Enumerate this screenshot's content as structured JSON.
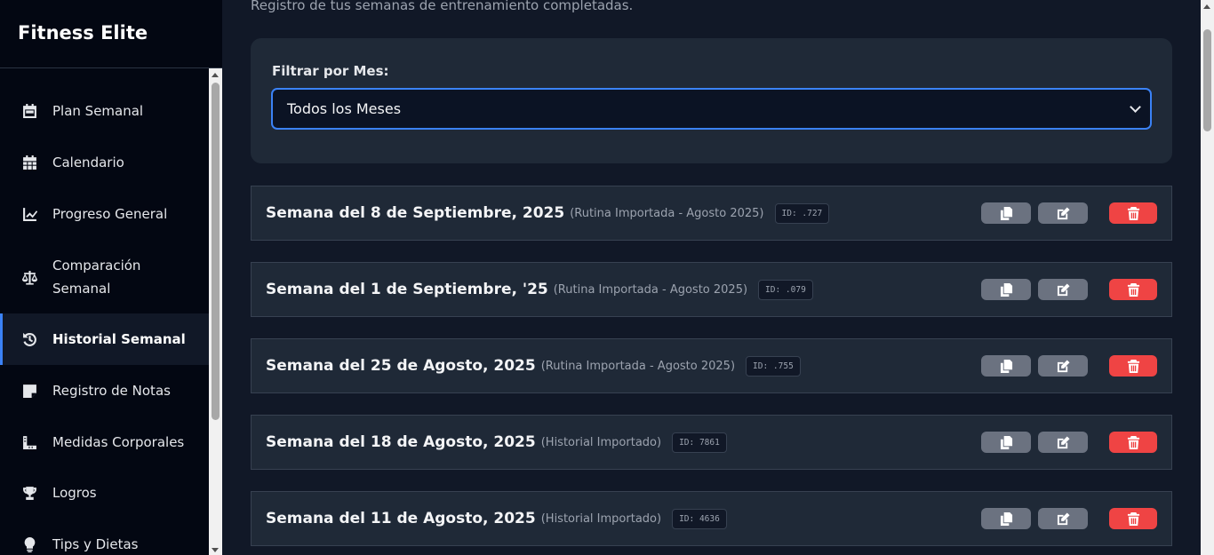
{
  "app": {
    "title": "Fitness Elite"
  },
  "sidebar": {
    "items": [
      {
        "label": "Plan Semanal",
        "icon": "calendar-day-icon"
      },
      {
        "label": "Calendario",
        "icon": "calendar-grid-icon"
      },
      {
        "label": "Progreso General",
        "icon": "line-chart-icon"
      },
      {
        "label": "Comparación Semanal",
        "icon": "balance-scale-icon"
      },
      {
        "label": "Historial Semanal",
        "icon": "history-icon",
        "active": true
      },
      {
        "label": "Registro de Notas",
        "icon": "sticky-note-icon"
      },
      {
        "label": "Medidas Corporales",
        "icon": "ruler-icon"
      },
      {
        "label": "Logros",
        "icon": "trophy-icon"
      },
      {
        "label": "Tips y Dietas",
        "icon": "lightbulb-icon"
      }
    ]
  },
  "main": {
    "subtitle": "Registro de tus semanas de entrenamiento completadas.",
    "filter": {
      "label": "Filtrar por Mes:",
      "selected": "Todos los Meses"
    },
    "weeks": [
      {
        "title": "Semana del 8 de Septiembre, 2025",
        "sub": "(Rutina Importada - Agosto 2025)",
        "id": "ID: .727"
      },
      {
        "title": "Semana del 1 de Septiembre, '25",
        "sub": "(Rutina Importada - Agosto 2025)",
        "id": "ID: .079"
      },
      {
        "title": "Semana del 25 de Agosto, 2025",
        "sub": "(Rutina Importada - Agosto 2025)",
        "id": "ID: .755"
      },
      {
        "title": "Semana del 18 de Agosto, 2025",
        "sub": "(Historial Importado)",
        "id": "ID: 7861"
      },
      {
        "title": "Semana del 11 de Agosto, 2025",
        "sub": "(Historial Importado)",
        "id": "ID: 4636"
      }
    ]
  },
  "colors": {
    "accent": "#3b82f6",
    "danger": "#ef4444",
    "neutral": "#6b7280"
  }
}
